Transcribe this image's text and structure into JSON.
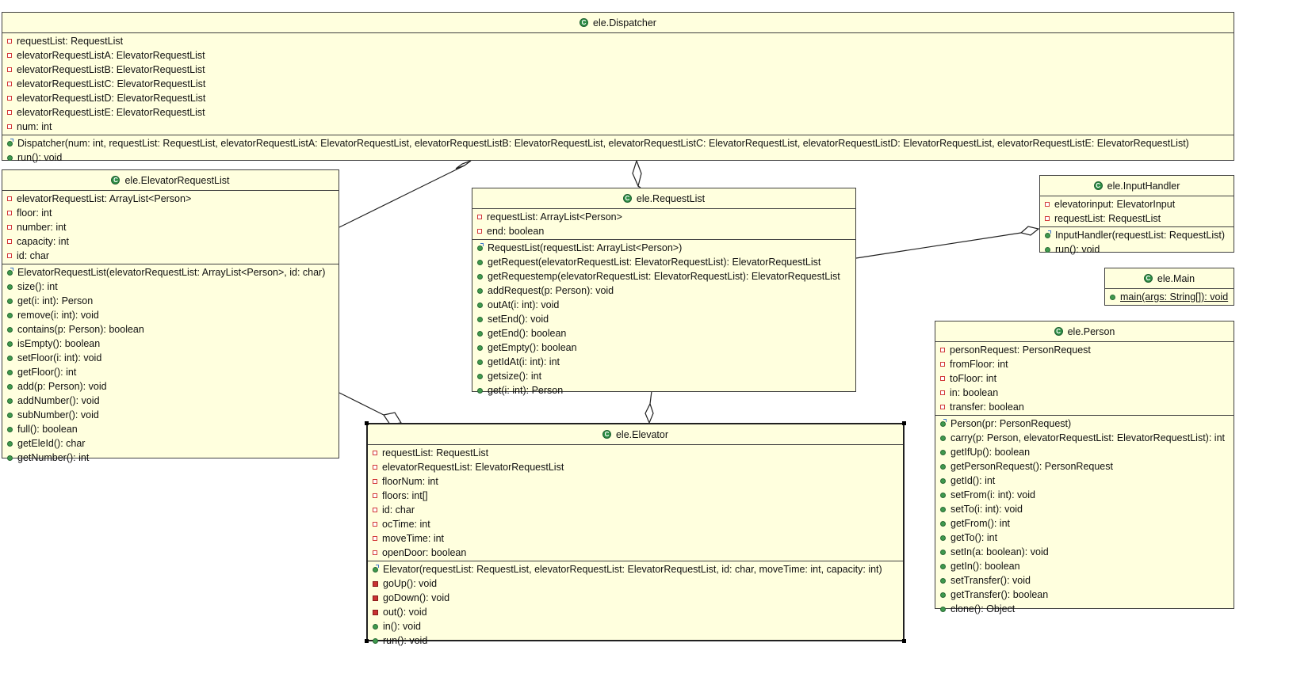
{
  "colors": {
    "class_fill": "#ffffde",
    "border": "#404040",
    "private_marker": "#d23a3a",
    "public_marker": "#3f9a4e",
    "class_icon": "#2f8f46",
    "constructor_marker": "#3b74c9"
  },
  "relations": [
    {
      "from": "ElevatorRequestList",
      "to": "Dispatcher",
      "kind": "aggregation"
    },
    {
      "from": "RequestList",
      "to": "Dispatcher",
      "kind": "aggregation"
    },
    {
      "from": "RequestList",
      "to": "InputHandler",
      "kind": "aggregation"
    },
    {
      "from": "RequestList",
      "to": "Elevator",
      "kind": "aggregation"
    },
    {
      "from": "ElevatorRequestList",
      "to": "Elevator",
      "kind": "aggregation"
    }
  ],
  "classes": {
    "dispatcher": {
      "name": "ele.Dispatcher",
      "icon": "class-icon",
      "attributes": [
        "requestList: RequestList",
        "elevatorRequestListA: ElevatorRequestList",
        "elevatorRequestListB: ElevatorRequestList",
        "elevatorRequestListC: ElevatorRequestList",
        "elevatorRequestListD: ElevatorRequestList",
        "elevatorRequestListE: ElevatorRequestList",
        "num: int"
      ],
      "methods": [
        "Dispatcher(num: int, requestList: RequestList, elevatorRequestListA: ElevatorRequestList, elevatorRequestListB: ElevatorRequestList, elevatorRequestListC: ElevatorRequestList, elevatorRequestListD: ElevatorRequestList, elevatorRequestListE: ElevatorRequestList)",
        "run(): void"
      ]
    },
    "elevator_request_list": {
      "name": "ele.ElevatorRequestList",
      "icon": "class-icon",
      "attributes": [
        "elevatorRequestList: ArrayList<Person>",
        "floor: int",
        "number: int",
        "capacity: int",
        "id: char"
      ],
      "methods": [
        "ElevatorRequestList(elevatorRequestList: ArrayList<Person>, id: char)",
        "size(): int",
        "get(i: int): Person",
        "remove(i: int): void",
        "contains(p: Person): boolean",
        "isEmpty(): boolean",
        "setFloor(i: int): void",
        "getFloor(): int",
        "add(p: Person): void",
        "addNumber(): void",
        "subNumber(): void",
        "full(): boolean",
        "getEleId(): char",
        "getNumber(): int"
      ]
    },
    "request_list": {
      "name": "ele.RequestList",
      "icon": "class-icon",
      "attributes": [
        "requestList: ArrayList<Person>",
        "end: boolean"
      ],
      "methods": [
        "RequestList(requestList: ArrayList<Person>)",
        "getRequest(elevatorRequestList: ElevatorRequestList): ElevatorRequestList",
        "getRequestemp(elevatorRequestList: ElevatorRequestList): ElevatorRequestList",
        "addRequest(p: Person): void",
        "outAt(i: int): void",
        "setEnd(): void",
        "getEnd(): boolean",
        "getEmpty(): boolean",
        "getIdAt(i: int): int",
        "getsize(): int",
        "get(i: int): Person"
      ]
    },
    "input_handler": {
      "name": "ele.InputHandler",
      "icon": "class-icon",
      "attributes": [
        "elevatorinput: ElevatorInput",
        "requestList: RequestList"
      ],
      "methods": [
        "InputHandler(requestList: RequestList)",
        "run(): void"
      ]
    },
    "main": {
      "name": "ele.Main",
      "icon": "class-icon",
      "methods": [
        "main(args: String[]): void"
      ]
    },
    "person": {
      "name": "ele.Person",
      "icon": "class-icon",
      "attributes": [
        "personRequest: PersonRequest",
        "fromFloor: int",
        "toFloor: int",
        "in: boolean",
        "transfer: boolean"
      ],
      "methods": [
        "Person(pr: PersonRequest)",
        "carry(p: Person, elevatorRequestList: ElevatorRequestList): int",
        "getIfUp(): boolean",
        "getPersonRequest(): PersonRequest",
        "getId(): int",
        "setFrom(i: int): void",
        "setTo(i: int): void",
        "getFrom(): int",
        "getTo(): int",
        "setIn(a: boolean): void",
        "getIn(): boolean",
        "setTransfer(): void",
        "getTransfer(): boolean",
        "clone(): Object"
      ]
    },
    "elevator": {
      "name": "ele.Elevator",
      "icon": "class-icon",
      "attributes": [
        "requestList: RequestList",
        "elevatorRequestList: ElevatorRequestList",
        "floorNum: int",
        "floors: int[]",
        "id: char",
        "ocTime: int",
        "moveTime: int",
        "openDoor: boolean"
      ],
      "methods": [
        "Elevator(requestList: RequestList, elevatorRequestList: ElevatorRequestList, id: char, moveTime: int, capacity: int)",
        "goUp(): void",
        "goDown(): void",
        "out(): void",
        "in(): void",
        "run(): void"
      ]
    }
  }
}
